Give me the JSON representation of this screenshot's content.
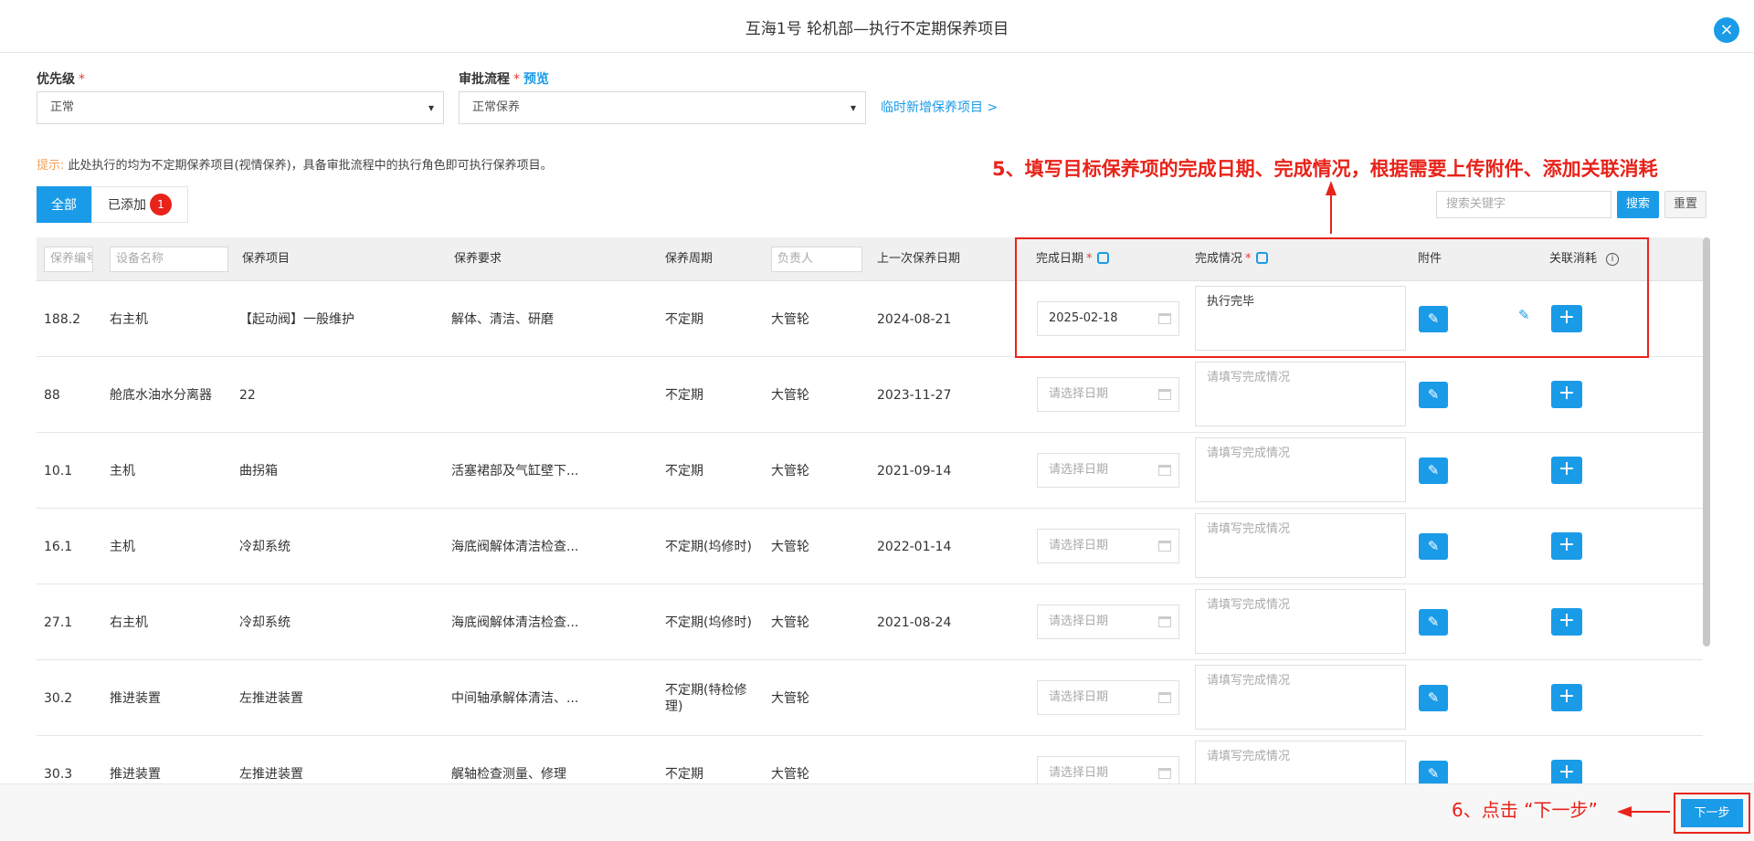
{
  "dialog": {
    "title": "互海1号 轮机部—执行不定期保养项目",
    "close_label": "×"
  },
  "form": {
    "priority_label": "优先级",
    "priority_value": "正常",
    "approval_label": "审批流程",
    "approval_preview": "预览",
    "approval_value": "正常保养",
    "required_mark": "*",
    "temp_add_link": "临时新增保养项目 >"
  },
  "hint": {
    "label": "提示:",
    "text": "此处执行的均为不定期保养项目(视情保养)，具备审批流程中的执行角色即可执行保养项目。"
  },
  "annotations": {
    "step5": "5、填写目标保养项的完成日期、完成情况，根据需要上传附件、添加关联消耗",
    "step6": "6、点击 “下一步”"
  },
  "tabs": {
    "all": "全部",
    "added": "已添加",
    "added_count": "1"
  },
  "search": {
    "placeholder": "搜索关键字",
    "search_btn": "搜索",
    "reset_btn": "重置"
  },
  "table": {
    "headers": {
      "code_placeholder": "保养编号",
      "device_placeholder": "设备名称",
      "item": "保养项目",
      "requirement": "保养要求",
      "cycle": "保养周期",
      "owner_placeholder": "负责人",
      "last_date": "上一次保养日期",
      "done_date": "完成日期",
      "done_status": "完成情况",
      "attachment": "附件",
      "consumption": "关联消耗",
      "info_glyph": "i"
    },
    "date_placeholder": "请选择日期",
    "status_placeholder": "请填写完成情况",
    "rows": [
      {
        "code": "188.2",
        "device": "右主机",
        "item": "【起动阀】一般维护",
        "requirement": "解体、清洁、研磨",
        "cycle": "不定期",
        "owner": "大管轮",
        "last": "2024-08-21",
        "done_date": "2025-02-18",
        "status": "执行完毕"
      },
      {
        "code": "88",
        "device": "舱底水油水分离器",
        "item": "22",
        "requirement": "",
        "cycle": "不定期",
        "owner": "大管轮",
        "last": "2023-11-27",
        "done_date": "",
        "status": ""
      },
      {
        "code": "10.1",
        "device": "主机",
        "item": "曲拐箱",
        "requirement": "活塞裙部及气缸壁下...",
        "cycle": "不定期",
        "owner": "大管轮",
        "last": "2021-09-14",
        "done_date": "",
        "status": ""
      },
      {
        "code": "16.1",
        "device": "主机",
        "item": "冷却系统",
        "requirement": "海底阀解体清洁检查...",
        "cycle": "不定期(坞修时)",
        "owner": "大管轮",
        "last": "2022-01-14",
        "done_date": "",
        "status": ""
      },
      {
        "code": "27.1",
        "device": "右主机",
        "item": "冷却系统",
        "requirement": "海底阀解体清洁检查...",
        "cycle": "不定期(坞修时)",
        "owner": "大管轮",
        "last": "2021-08-24",
        "done_date": "",
        "status": ""
      },
      {
        "code": "30.2",
        "device": "推进装置",
        "item": "左推进装置",
        "requirement": "中间轴承解体清洁、...",
        "cycle": "不定期(特检修理)",
        "owner": "大管轮",
        "last": "",
        "done_date": "",
        "status": ""
      },
      {
        "code": "30.3",
        "device": "推进装置",
        "item": "左推进装置",
        "requirement": "艉轴检查测量、修理",
        "cycle": "不定期",
        "owner": "大管轮",
        "last": "",
        "done_date": "",
        "status": ""
      }
    ]
  },
  "icons": {
    "attach": "paperclip-icon",
    "plus": "plus-icon",
    "edit": "edit-icon",
    "calendar": "calendar-icon",
    "paperclip_glyph": "✎",
    "plus_glyph": "+"
  },
  "footer": {
    "next_btn": "下一步"
  },
  "colors": {
    "primary": "#1a9be8",
    "annotation": "#e8231a"
  }
}
